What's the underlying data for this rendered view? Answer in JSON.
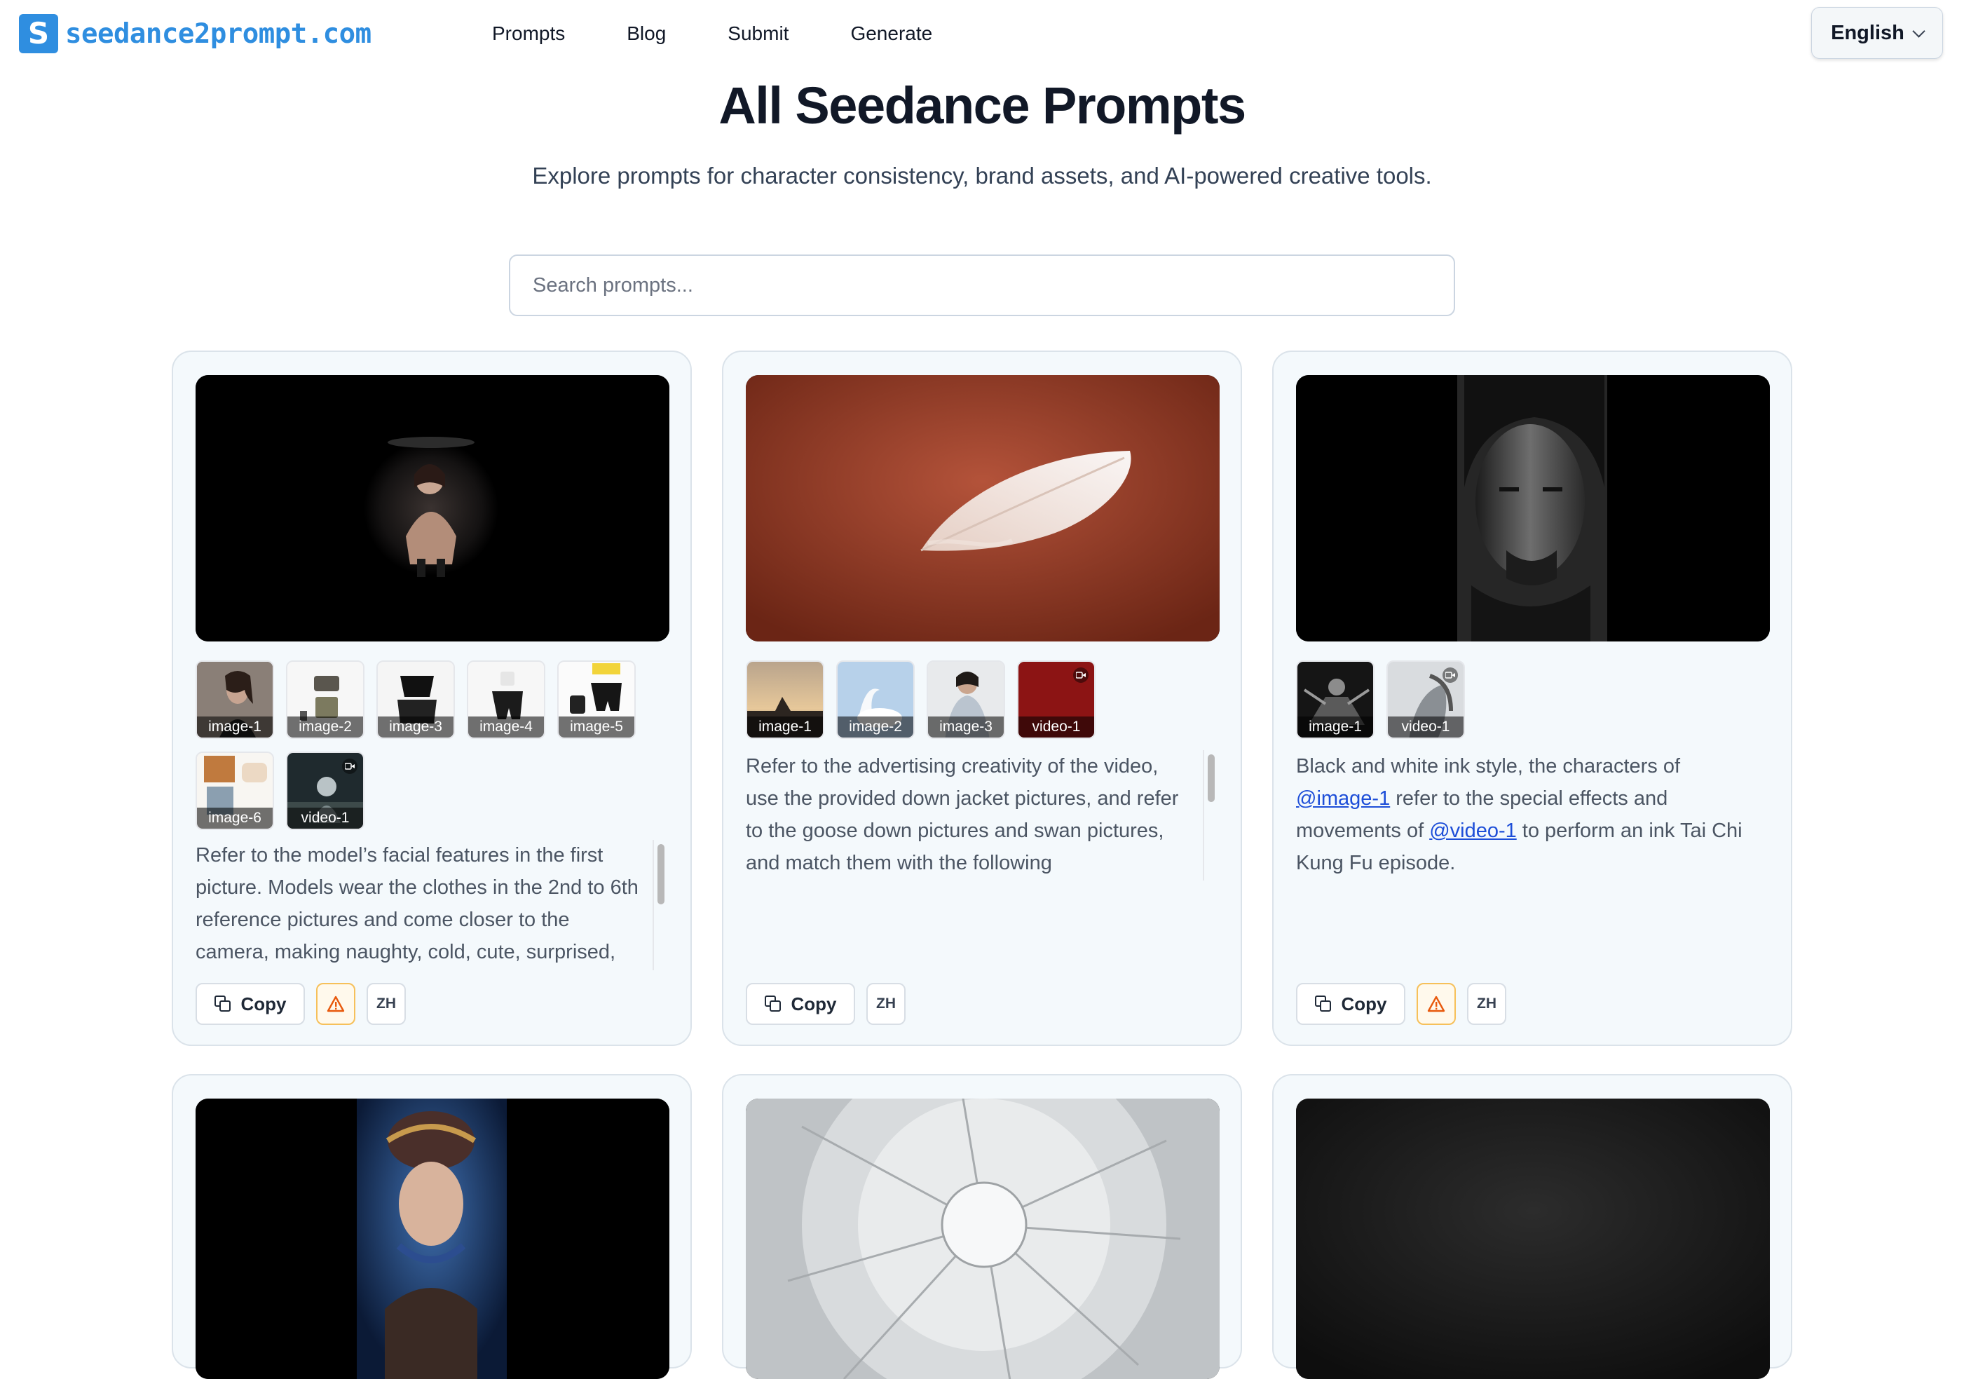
{
  "header": {
    "logo_mark": "S",
    "logo_text": "seedance2prompt.com",
    "nav": [
      "Prompts",
      "Blog",
      "Submit",
      "Generate"
    ],
    "language": "English"
  },
  "page": {
    "title": "All Seedance Prompts",
    "subtitle": "Explore prompts for character consistency, brand assets, and AI-powered creative tools.",
    "search_placeholder": "Search prompts..."
  },
  "cards": [
    {
      "refs": [
        "image-1",
        "image-2",
        "image-3",
        "image-4",
        "image-5",
        "image-6",
        "video-1"
      ],
      "description": "Refer to the model’s facial features in the first picture. Models wear the clothes in the 2nd to 6th reference pictures and come closer to the camera, making naughty, cold, cute, surprised,",
      "copy_label": "Copy",
      "lang_label": "ZH",
      "warning_icon": "warning-icon"
    },
    {
      "refs": [
        "image-1",
        "image-2",
        "image-3",
        "video-1"
      ],
      "description": "Refer to the advertising creativity of the video, use the provided down jacket pictures, and refer to the goose down pictures and swan pictures, and match them with the following",
      "copy_label": "Copy",
      "lang_label": "ZH"
    },
    {
      "refs": [
        "image-1",
        "video-1"
      ],
      "description_parts": {
        "t1": "Black and white ink style, the characters of ",
        "m1": "@image-1",
        "t2": " refer to the special effects and movements of ",
        "m2": "@video-1",
        "t3": " to perform an ink Tai Chi Kung Fu episode."
      },
      "copy_label": "Copy",
      "lang_label": "ZH",
      "warning_icon": "warning-icon"
    }
  ],
  "colors": {
    "brand": "#2f8ee0",
    "card_bg": "#f4f9fc",
    "link": "#1d4ed8",
    "warning": "#f6a609"
  }
}
